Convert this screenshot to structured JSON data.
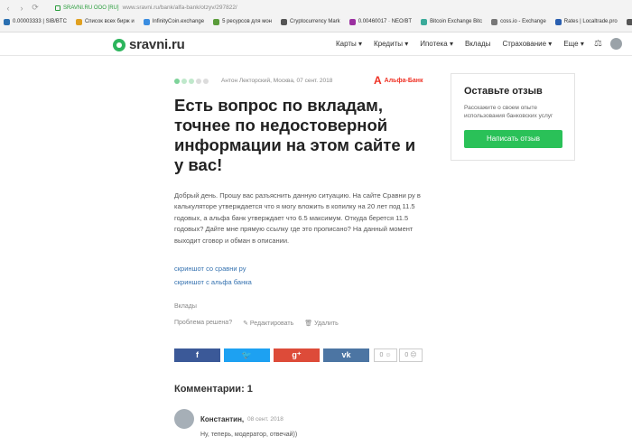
{
  "browser": {
    "secure_label": "SRAVNI.RU ООО [RU]",
    "url": "www.sravni.ru/bank/alfa-bank/otzyv/297822/",
    "bookmarks": [
      {
        "label": "0.00003333 | SIB/BTC",
        "color": "#2a6fb0"
      },
      {
        "label": "Список всех бирж и",
        "color": "#e0a020"
      },
      {
        "label": "InfinityCoin.exchange",
        "color": "#3a8de0"
      },
      {
        "label": "5 ресурсов для мон",
        "color": "#5a9c3a"
      },
      {
        "label": "Cryptocurrency Mark",
        "color": "#555555"
      },
      {
        "label": "0.00460017 · NEO/BT",
        "color": "#9b2fa0"
      },
      {
        "label": "Bitcoin Exchange Bitc",
        "color": "#3aaa9a"
      },
      {
        "label": "coss.io - Exchange",
        "color": "#777777"
      },
      {
        "label": "Rates | Localtrade.pro",
        "color": "#2a5fb0"
      },
      {
        "label": "Обу",
        "color": "#555555"
      }
    ]
  },
  "header": {
    "logo": "sravni.ru",
    "nav": [
      "Карты ▾",
      "Кредиты ▾",
      "Ипотека ▾",
      "Вклады",
      "Страхование ▾",
      "Еще ▾"
    ]
  },
  "review": {
    "meta": "Антон Лекторский, Москва, 07 сент. 2018",
    "bank_name": "Альфа-Банк",
    "title": "Есть вопрос по вкладам, точнее по недостоверной информации на этом сайте и у вас!",
    "text": "Добрый день. Прошу вас разъяснить данную ситуацию. На сайте Сравни ру в калькуляторе утверждается что я могу вложить в копилку на 20 лет под 11.5 годовых, а альфа банк утверждает что 6.5 максимум. Откуда берется 11.5 годовых? Дайте мне прямую ссылку где это прописано? На данный момент выходит сговор и обман в описании.",
    "link1": "скриншот со сравни ру",
    "link2": "скриншот с альфа банка",
    "tag": "Вклады",
    "problem_solved": "Проблема решена?",
    "edit": "✎ Редактировать",
    "delete": "🗑 Удалить",
    "votes_up": "0 ☺",
    "votes_down": "0 ☹"
  },
  "share": {
    "fb": "f",
    "tw": "🐦",
    "gp": "g⁺",
    "vk": "vk"
  },
  "comments": {
    "title": "Комментарии: 1",
    "items": [
      {
        "author": "Константин,",
        "date": "08 сент. 2018",
        "text": "Ну, теперь, модератор, отвечай))"
      }
    ]
  },
  "sidebar": {
    "title": "Оставьте отзыв",
    "text": "Расскажите о своем опыте использования банковских услуг",
    "button": "Написать отзыв"
  },
  "colors": {
    "accent": "#2ac158",
    "fb": "#3b5998",
    "tw": "#1da1f2",
    "gp": "#dd4b39",
    "vk": "#4c75a3",
    "bank": "#ef3124"
  }
}
